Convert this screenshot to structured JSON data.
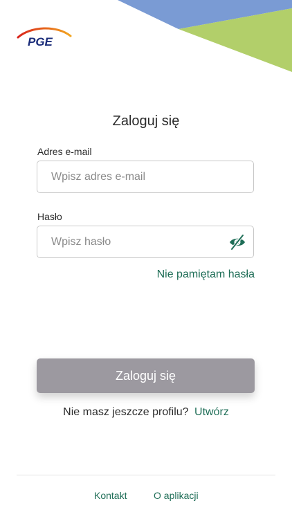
{
  "brand": {
    "logo_text": "PGE",
    "colors": {
      "blue_band": "#7a9bd4",
      "green_band": "#b2cf6a",
      "accent_green": "#1f6e57",
      "button_disabled": "#9c99a0"
    }
  },
  "login": {
    "title": "Zaloguj się",
    "email_label": "Adres e-mail",
    "email_placeholder": "Wpisz adres e-mail",
    "email_value": "",
    "password_label": "Hasło",
    "password_placeholder": "Wpisz hasło",
    "password_value": "",
    "password_toggle_icon": "eye-off-icon",
    "forgot_password": "Nie pamiętam hasła",
    "submit_label": "Zaloguj się",
    "no_profile_text": "Nie masz jeszcze profilu?",
    "create_link": "Utwórz"
  },
  "footer": {
    "contact": "Kontakt",
    "about": "O aplikacji"
  }
}
